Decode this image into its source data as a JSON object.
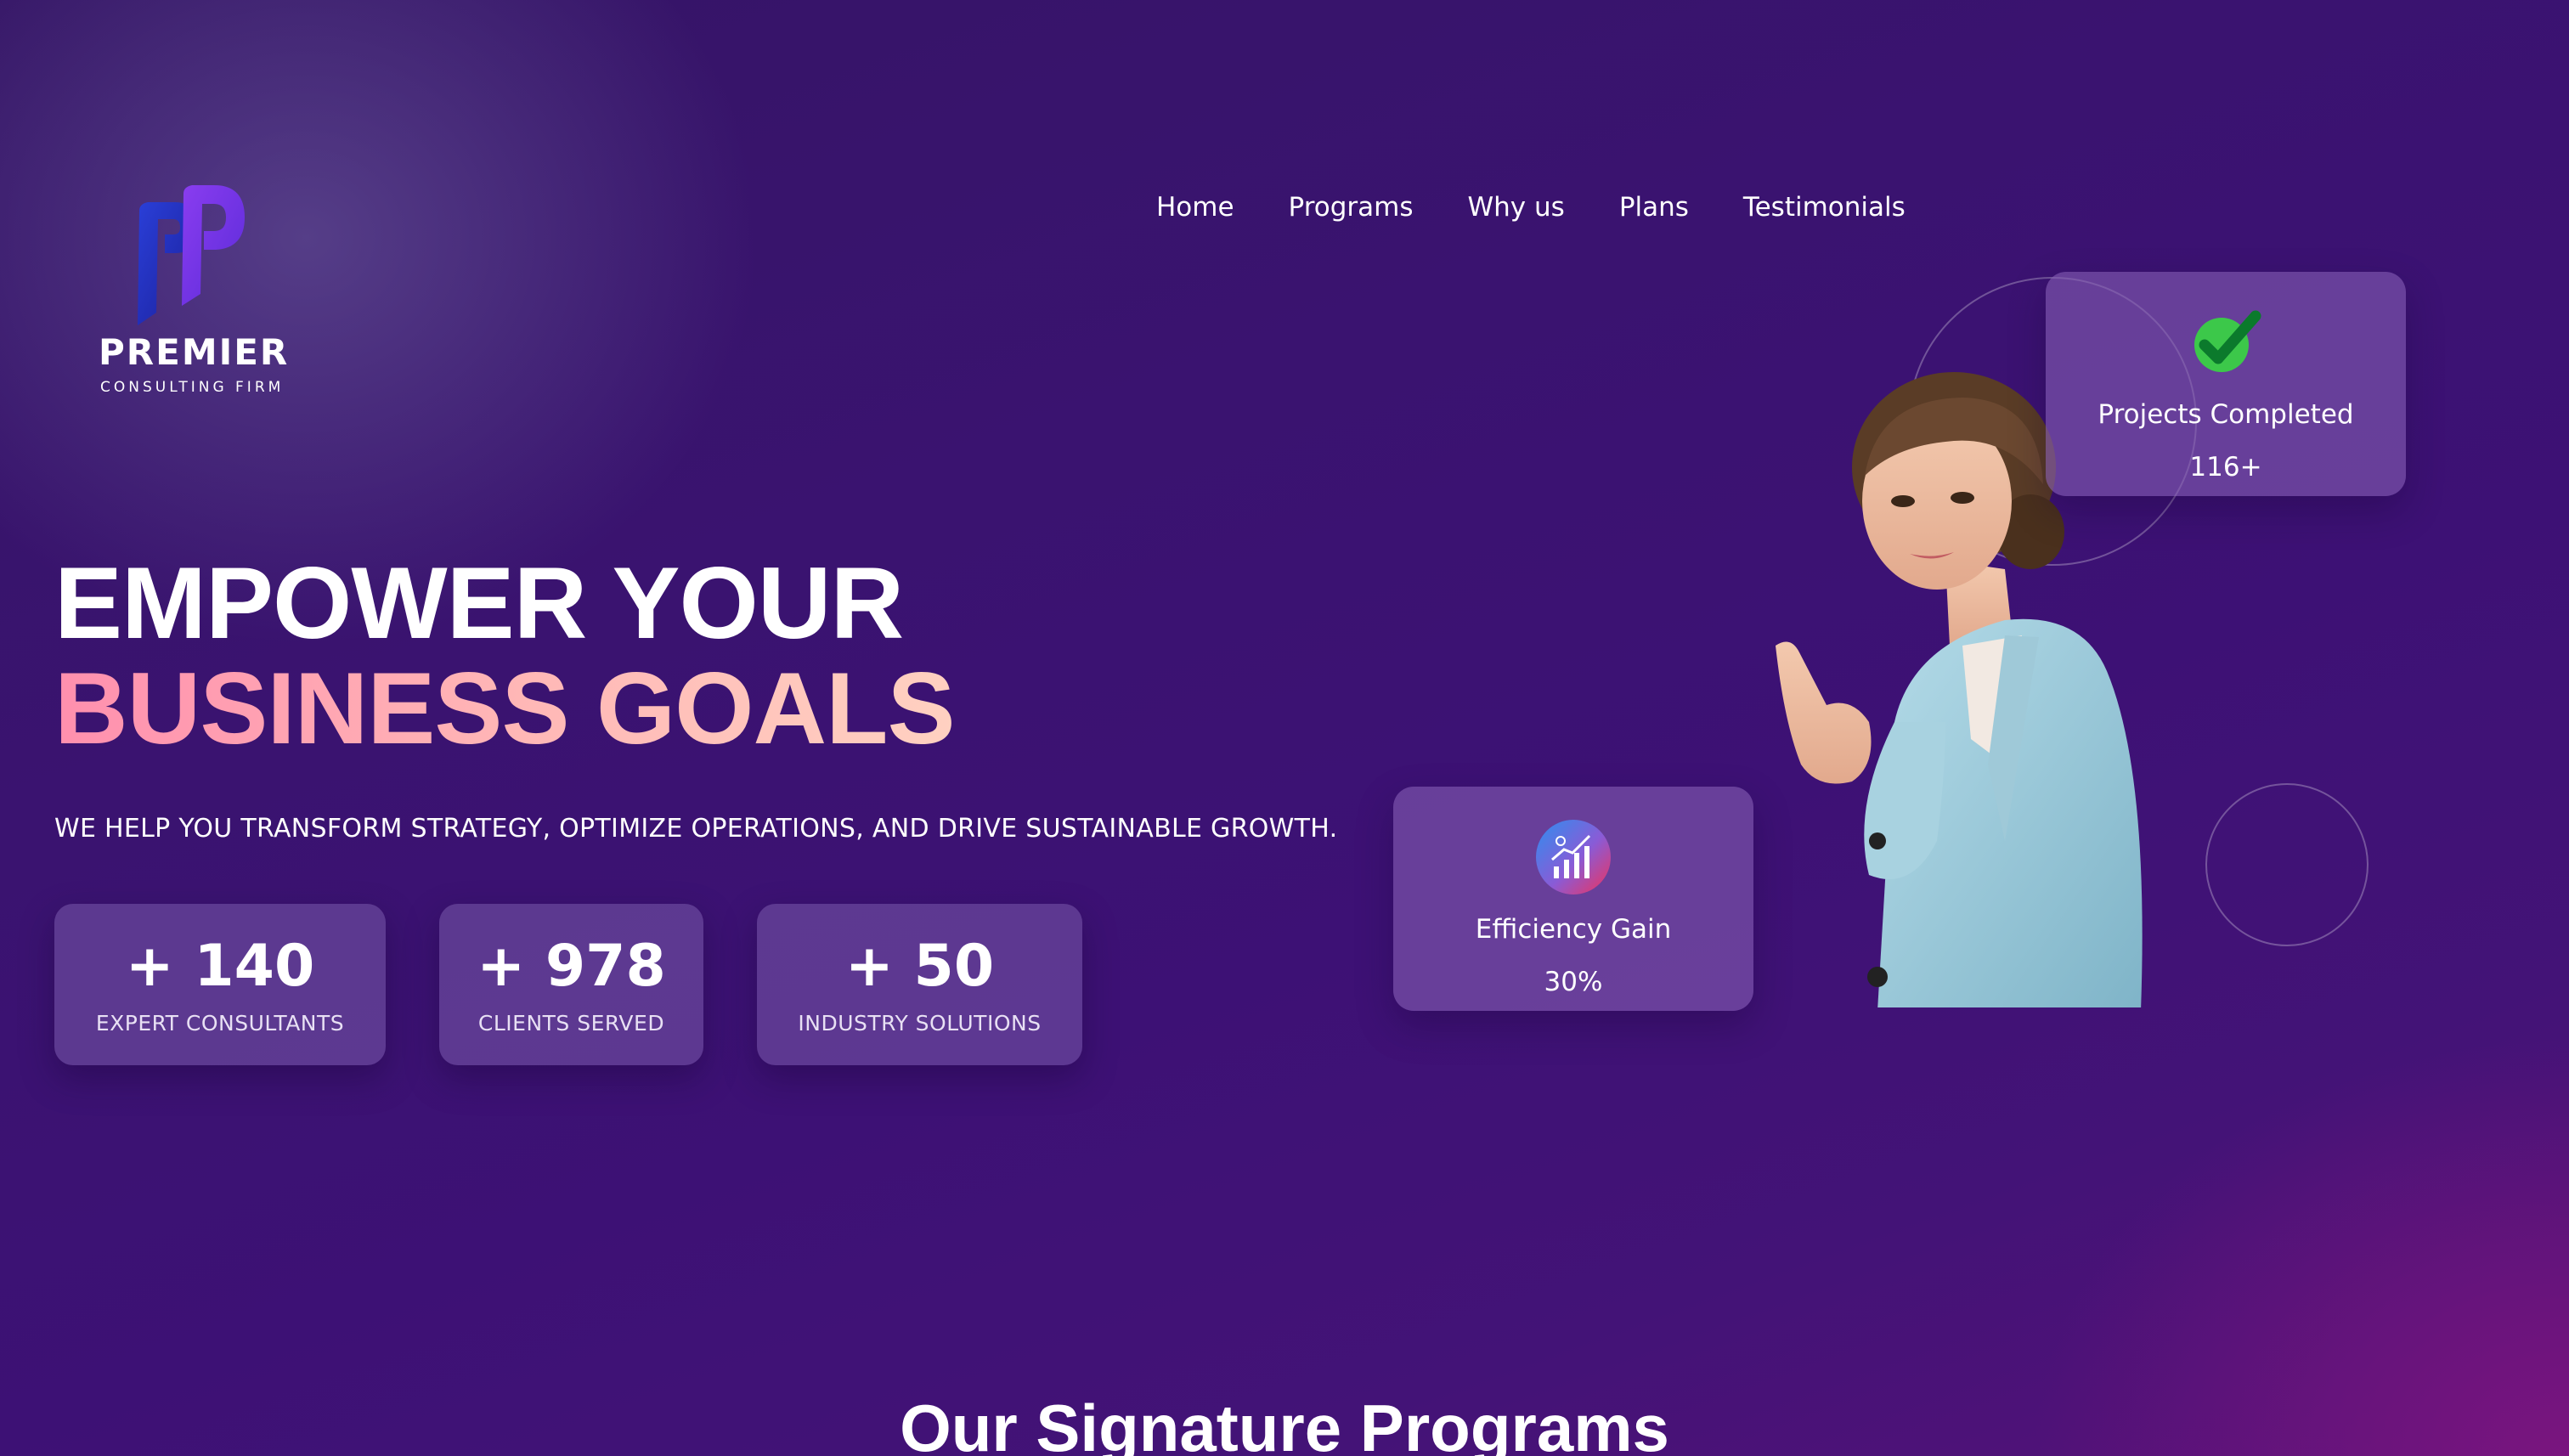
{
  "colors": {
    "background": "#3a1370",
    "headline_accent_start": "#ff8fae",
    "headline_accent_end": "#ffd1c1",
    "card_background": "#7a5aa8",
    "check_green": "#3cc84a"
  },
  "brand": {
    "logo_icon": "pp-monogram-logo",
    "name": "PREMIER",
    "subtitle": "CONSULTING FIRM"
  },
  "nav": {
    "items": [
      {
        "label": "Home"
      },
      {
        "label": "Programs"
      },
      {
        "label": "Why us"
      },
      {
        "label": "Plans"
      },
      {
        "label": "Testimonials"
      }
    ]
  },
  "hero": {
    "headline_line1": "EMPOWER YOUR",
    "headline_line2": "BUSINESS GOALS",
    "tagline": "WE HELP YOU TRANSFORM STRATEGY, OPTIMIZE OPERATIONS, AND DRIVE SUSTAINABLE GROWTH.",
    "image_icon": "businesswoman-pointing-image"
  },
  "stats": [
    {
      "value": "+ 140",
      "label": "EXPERT CONSULTANTS"
    },
    {
      "value": "+ 978",
      "label": "CLIENTS SERVED"
    },
    {
      "value": "+ 50",
      "label": "INDUSTRY SOLUTIONS"
    }
  ],
  "cards": {
    "projects": {
      "icon": "check-icon",
      "title": "Projects Completed",
      "value": "116+"
    },
    "efficiency": {
      "icon": "growth-chart-icon",
      "title": "Efficiency Gain",
      "value": "30%"
    }
  },
  "section": {
    "title": "Our Signature Programs"
  }
}
